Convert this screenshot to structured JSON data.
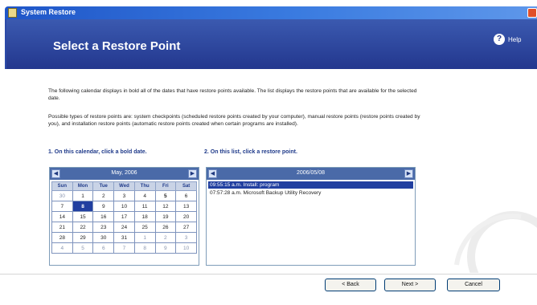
{
  "window": {
    "title": "System Restore"
  },
  "banner": {
    "heading": "Select a Restore Point",
    "help_label": "Help"
  },
  "intro": {
    "p1": "The following calendar displays in bold all of the dates that have restore points available. The list displays the restore points that are available for the selected date.",
    "p2": "Possible types of restore points are: system checkpoints (scheduled restore points created by your computer), manual restore points (restore points created by you), and installation restore points (automatic restore points created when certain programs are installed)."
  },
  "steps": {
    "calendar_label": "1. On this calendar, click a bold date.",
    "list_label": "2. On this list, click a restore point."
  },
  "calendar": {
    "month_label": "May, 2006",
    "days": [
      "Sun",
      "Mon",
      "Tue",
      "Wed",
      "Thu",
      "Fri",
      "Sat"
    ],
    "weeks": [
      [
        {
          "d": "30",
          "m": true
        },
        {
          "d": "1"
        },
        {
          "d": "2"
        },
        {
          "d": "3"
        },
        {
          "d": "4"
        },
        {
          "d": "5",
          "b": true
        },
        {
          "d": "6"
        }
      ],
      [
        {
          "d": "7"
        },
        {
          "d": "8",
          "s": true,
          "b": true
        },
        {
          "d": "9"
        },
        {
          "d": "10"
        },
        {
          "d": "11"
        },
        {
          "d": "12"
        },
        {
          "d": "13"
        }
      ],
      [
        {
          "d": "14"
        },
        {
          "d": "15"
        },
        {
          "d": "16"
        },
        {
          "d": "17"
        },
        {
          "d": "18"
        },
        {
          "d": "19"
        },
        {
          "d": "20"
        }
      ],
      [
        {
          "d": "21"
        },
        {
          "d": "22"
        },
        {
          "d": "23"
        },
        {
          "d": "24"
        },
        {
          "d": "25"
        },
        {
          "d": "26"
        },
        {
          "d": "27"
        }
      ],
      [
        {
          "d": "28"
        },
        {
          "d": "29"
        },
        {
          "d": "30"
        },
        {
          "d": "31"
        },
        {
          "d": "1",
          "m": true
        },
        {
          "d": "2",
          "m": true
        },
        {
          "d": "3",
          "m": true
        }
      ],
      [
        {
          "d": "4",
          "m": true
        },
        {
          "d": "5",
          "m": true
        },
        {
          "d": "6",
          "m": true
        },
        {
          "d": "7",
          "m": true
        },
        {
          "d": "8",
          "m": true
        },
        {
          "d": "9",
          "m": true
        },
        {
          "d": "10",
          "m": true
        }
      ]
    ]
  },
  "restore_list": {
    "date_label": "2006/05/08",
    "rows": [
      "09:55:15 a.m.   Install: program",
      "07:57:28 a.m.   Microsoft Backup Utility Recovery"
    ]
  },
  "buttons": {
    "back": "< Back",
    "next": "Next >",
    "cancel": "Cancel"
  },
  "colors": {
    "banner": "#23378e",
    "selection": "#213fa0",
    "titlebar": "#1f56c8"
  }
}
